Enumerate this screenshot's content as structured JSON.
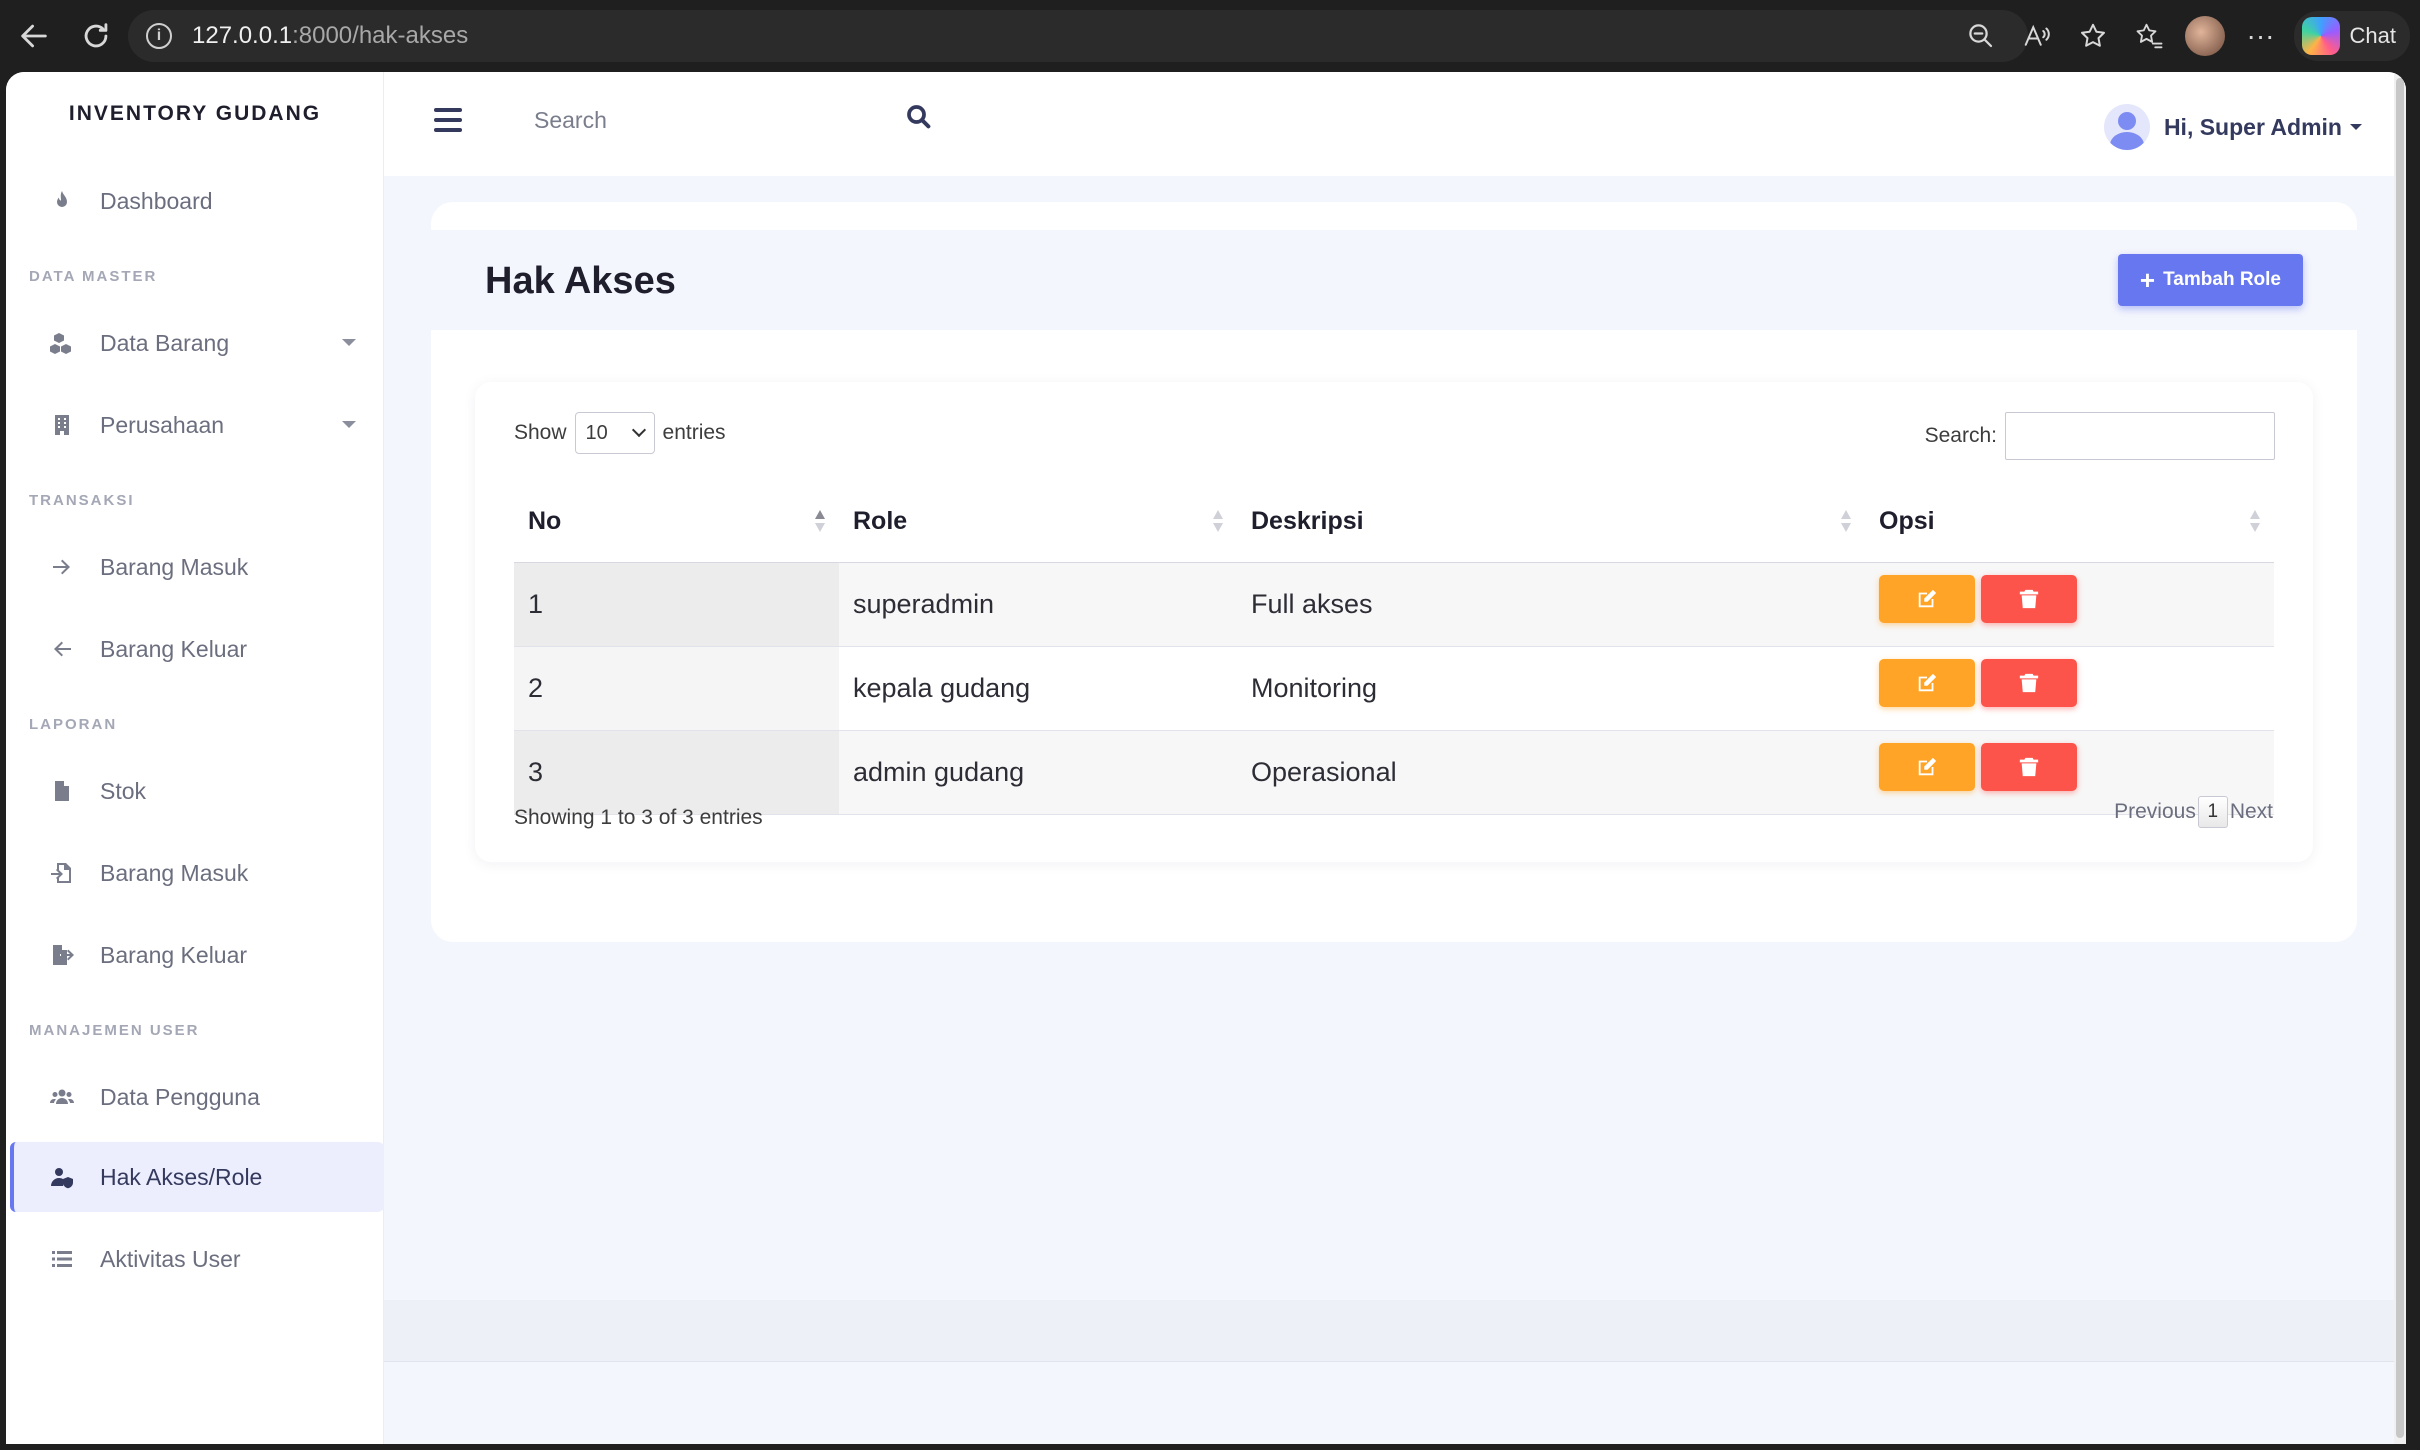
{
  "browser": {
    "url_host": "127.0.0.1",
    "url_rest": ":8000/hak-akses",
    "chat_label": "Chat"
  },
  "sidebar": {
    "brand": "INVENTORY GUDANG",
    "dashboard": "Dashboard",
    "headers": {
      "master": "DATA MASTER",
      "transaksi": "TRANSAKSI",
      "laporan": "LAPORAN",
      "manajemen": "MANAJEMEN USER"
    },
    "items": {
      "data_barang": "Data Barang",
      "perusahaan": "Perusahaan",
      "barang_masuk": "Barang Masuk",
      "barang_keluar": "Barang Keluar",
      "stok": "Stok",
      "lap_barang_masuk": "Barang Masuk",
      "lap_barang_keluar": "Barang Keluar",
      "data_pengguna": "Data Pengguna",
      "hak_akses": "Hak Akses/Role",
      "aktivitas": "Aktivitas User"
    }
  },
  "topbar": {
    "search_placeholder": "Search",
    "user_greeting": "Hi, Super Admin"
  },
  "main": {
    "title": "Hak Akses",
    "add_button": "Tambah Role",
    "show_label": "Show",
    "entries_label": "entries",
    "page_length": "10",
    "search_label": "Search:",
    "columns": [
      "No",
      "Role",
      "Deskripsi",
      "Opsi"
    ],
    "rows": [
      {
        "no": "1",
        "role": "superadmin",
        "deskripsi": "Full akses"
      },
      {
        "no": "2",
        "role": "kepala gudang",
        "deskripsi": "Monitoring"
      },
      {
        "no": "3",
        "role": "admin gudang",
        "deskripsi": "Operasional"
      }
    ],
    "info": "Showing 1 to 3 of 3 entries",
    "previous": "Previous",
    "page": "1",
    "next": "Next"
  },
  "colors": {
    "primary": "#6777ef",
    "warning": "#ffa426",
    "danger": "#fc544b"
  }
}
